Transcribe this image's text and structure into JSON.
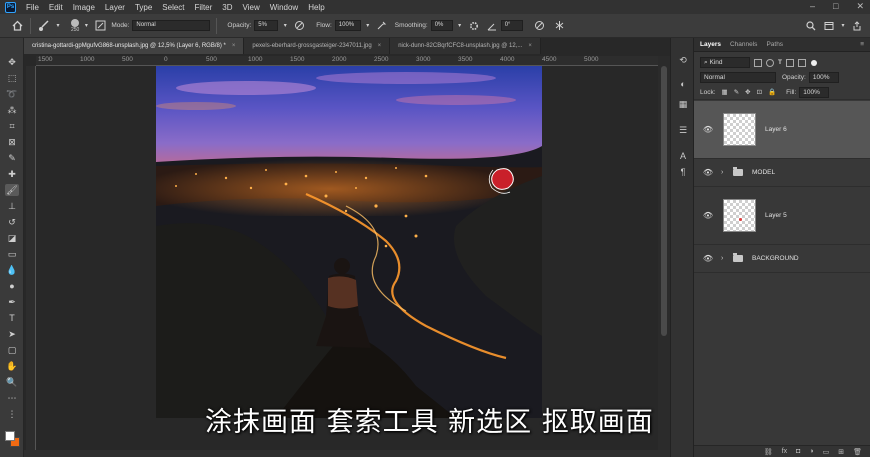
{
  "menubar": {
    "logo": "Ps",
    "items": [
      "File",
      "Edit",
      "Image",
      "Layer",
      "Type",
      "Select",
      "Filter",
      "3D",
      "View",
      "Window",
      "Help"
    ],
    "window_controls": [
      "–",
      "□",
      "✕"
    ]
  },
  "options": {
    "brush_size": "250",
    "mode_label": "Mode:",
    "mode_value": "Normal",
    "opacity_label": "Opacity:",
    "opacity_value": "5%",
    "flow_label": "Flow:",
    "flow_value": "100%",
    "smoothing_label": "Smoothing:",
    "smoothing_value": "0%",
    "angle_value": "0°"
  },
  "tabs": [
    {
      "label": "cristina-gottardi-gpMgufvG868-unsplash.jpg @ 12,5% (Layer 6, RGB/8) *",
      "active": true
    },
    {
      "label": "pexels-eberhard-grossgasteiger-2347011.jpg",
      "active": false
    },
    {
      "label": "nick-dunn-82CBqrfCFC8-unsplash.jpg @ 12,...",
      "active": false
    }
  ],
  "ruler": {
    "labels": [
      "1500",
      "1000",
      "500",
      "0",
      "500",
      "1000",
      "1500",
      "2000",
      "2500",
      "3000",
      "3500",
      "4000",
      "4500",
      "5000"
    ]
  },
  "subtitle": "涂抹画面 套索工具 新选区 抠取画面",
  "layers_panel": {
    "tabs": [
      "Layers",
      "Channels",
      "Paths"
    ],
    "filter_label": "Kind",
    "blend_mode": "Normal",
    "opacity_label": "Opacity:",
    "opacity_value": "100%",
    "lock_label": "Lock:",
    "fill_label": "Fill:",
    "fill_value": "100%",
    "layers": [
      {
        "name": "Layer 6",
        "type": "pixel",
        "active": true
      },
      {
        "name": "MODEL",
        "type": "group",
        "active": false
      },
      {
        "name": "Layer 5",
        "type": "pixel",
        "active": false
      },
      {
        "name": "BACKGROUND",
        "type": "group",
        "active": false
      }
    ]
  },
  "colors": {
    "foreground": "#ffffff",
    "background": "#f06a13"
  },
  "icons": {
    "home": "home-icon",
    "brush": "brush-icon",
    "eye": "eye-icon",
    "folder": "folder-icon"
  }
}
